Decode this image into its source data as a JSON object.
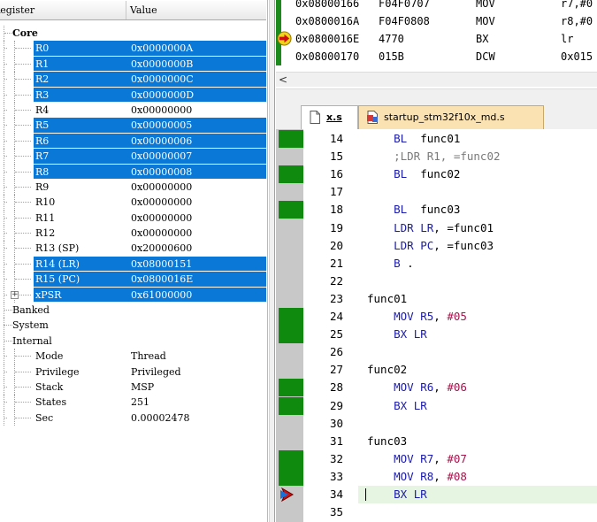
{
  "registers": {
    "header": {
      "name": "Register",
      "value": "Value"
    },
    "rows": [
      {
        "name": "Core",
        "value": "",
        "indent": 1,
        "bold": true,
        "selected": false
      },
      {
        "name": "R0",
        "value": "0x0000000A",
        "indent": 2,
        "selected": true
      },
      {
        "name": "R1",
        "value": "0x0000000B",
        "indent": 2,
        "selected": true
      },
      {
        "name": "R2",
        "value": "0x0000000C",
        "indent": 2,
        "selected": true
      },
      {
        "name": "R3",
        "value": "0x0000000D",
        "indent": 2,
        "selected": true
      },
      {
        "name": "R4",
        "value": "0x00000000",
        "indent": 2,
        "selected": false
      },
      {
        "name": "R5",
        "value": "0x00000005",
        "indent": 2,
        "selected": true
      },
      {
        "name": "R6",
        "value": "0x00000006",
        "indent": 2,
        "selected": true
      },
      {
        "name": "R7",
        "value": "0x00000007",
        "indent": 2,
        "selected": true
      },
      {
        "name": "R8",
        "value": "0x00000008",
        "indent": 2,
        "selected": true
      },
      {
        "name": "R9",
        "value": "0x00000000",
        "indent": 2,
        "selected": false
      },
      {
        "name": "R10",
        "value": "0x00000000",
        "indent": 2,
        "selected": false
      },
      {
        "name": "R11",
        "value": "0x00000000",
        "indent": 2,
        "selected": false
      },
      {
        "name": "R12",
        "value": "0x00000000",
        "indent": 2,
        "selected": false
      },
      {
        "name": "R13 (SP)",
        "value": "0x20000600",
        "indent": 2,
        "selected": false
      },
      {
        "name": "R14 (LR)",
        "value": "0x08000151",
        "indent": 2,
        "selected": true
      },
      {
        "name": "R15 (PC)",
        "value": "0x0800016E",
        "indent": 2,
        "selected": true
      },
      {
        "name": "xPSR",
        "value": "0x61000000",
        "indent": 2,
        "selected": true,
        "expandable": true,
        "expand_symbol": "+"
      },
      {
        "name": "Banked",
        "value": "",
        "indent": 0,
        "selected": false
      },
      {
        "name": "System",
        "value": "",
        "indent": 0,
        "selected": false
      },
      {
        "name": "Internal",
        "value": "",
        "indent": 0,
        "selected": false
      },
      {
        "name": "Mode",
        "value": "Thread",
        "indent": 2,
        "selected": false
      },
      {
        "name": "Privilege",
        "value": "Privileged",
        "indent": 2,
        "selected": false
      },
      {
        "name": "Stack",
        "value": "MSP",
        "indent": 2,
        "selected": false
      },
      {
        "name": "States",
        "value": "251",
        "indent": 2,
        "selected": false
      },
      {
        "name": "Sec",
        "value": "0.00002478",
        "indent": 2,
        "selected": false
      }
    ]
  },
  "disassembly": {
    "rows": [
      {
        "addr": "0x08000166",
        "opcode": "F04F0707",
        "mnemonic": "MOV",
        "operand": "r7,#0",
        "executed": true,
        "pc": false
      },
      {
        "addr": "0x0800016A",
        "opcode": "F04F0808",
        "mnemonic": "MOV",
        "operand": "r8,#0",
        "executed": true,
        "pc": false
      },
      {
        "addr": "0x0800016E",
        "opcode": "4770",
        "mnemonic": "BX",
        "operand": "lr",
        "executed": true,
        "pc": true
      },
      {
        "addr": "0x08000170",
        "opcode": "015B",
        "mnemonic": "DCW",
        "operand": "0x015",
        "executed": true,
        "pc": false
      }
    ],
    "scroll_left_symbol": "<"
  },
  "tabs": [
    {
      "label": "x.s",
      "active": true
    },
    {
      "label": "startup_stm32f10x_md.s",
      "active": false
    }
  ],
  "editor": {
    "lines": [
      {
        "n": "14",
        "tokens": [
          [
            "kw",
            "    BL  "
          ],
          [
            "pl",
            "func01"
          ]
        ],
        "mark": true
      },
      {
        "n": "15",
        "tokens": [
          [
            "cm",
            "    ;LDR R1, =func02"
          ]
        ],
        "mark": false
      },
      {
        "n": "16",
        "tokens": [
          [
            "kw",
            "    BL  "
          ],
          [
            "pl",
            "func02"
          ]
        ],
        "mark": true
      },
      {
        "n": "17",
        "tokens": [],
        "mark": false
      },
      {
        "n": "18",
        "tokens": [
          [
            "kw",
            "    BL  "
          ],
          [
            "pl",
            "func03"
          ]
        ],
        "mark": true
      },
      {
        "n": "19",
        "tokens": [
          [
            "kw",
            "    LDR "
          ],
          [
            "rg",
            "LR"
          ],
          [
            "pl",
            ", =func01"
          ]
        ],
        "mark": false
      },
      {
        "n": "20",
        "tokens": [
          [
            "kw",
            "    LDR "
          ],
          [
            "rg",
            "PC"
          ],
          [
            "pl",
            ", =func03"
          ]
        ],
        "mark": false
      },
      {
        "n": "21",
        "tokens": [
          [
            "kw",
            "    B "
          ],
          [
            "pl",
            "."
          ]
        ],
        "mark": false
      },
      {
        "n": "22",
        "tokens": [],
        "mark": false
      },
      {
        "n": "23",
        "tokens": [
          [
            "pl",
            "func01"
          ]
        ],
        "mark": false
      },
      {
        "n": "24",
        "tokens": [
          [
            "kw",
            "    MOV "
          ],
          [
            "rg",
            "R5"
          ],
          [
            "pl",
            ", "
          ],
          [
            "nm",
            "#05"
          ]
        ],
        "mark": true
      },
      {
        "n": "25",
        "tokens": [
          [
            "kw",
            "    BX "
          ],
          [
            "rg",
            "LR"
          ]
        ],
        "mark": true
      },
      {
        "n": "26",
        "tokens": [],
        "mark": false
      },
      {
        "n": "27",
        "tokens": [
          [
            "pl",
            "func02"
          ]
        ],
        "mark": false
      },
      {
        "n": "28",
        "tokens": [
          [
            "kw",
            "    MOV "
          ],
          [
            "rg",
            "R6"
          ],
          [
            "pl",
            ", "
          ],
          [
            "nm",
            "#06"
          ]
        ],
        "mark": true
      },
      {
        "n": "29",
        "tokens": [
          [
            "kw",
            "    BX "
          ],
          [
            "rg",
            "LR"
          ]
        ],
        "mark": true
      },
      {
        "n": "30",
        "tokens": [],
        "mark": false
      },
      {
        "n": "31",
        "tokens": [
          [
            "pl",
            "func03"
          ]
        ],
        "mark": false
      },
      {
        "n": "32",
        "tokens": [
          [
            "kw",
            "    MOV "
          ],
          [
            "rg",
            "R7"
          ],
          [
            "pl",
            ", "
          ],
          [
            "nm",
            "#07"
          ]
        ],
        "mark": true
      },
      {
        "n": "33",
        "tokens": [
          [
            "kw",
            "    MOV "
          ],
          [
            "rg",
            "R8"
          ],
          [
            "pl",
            ", "
          ],
          [
            "nm",
            "#08"
          ]
        ],
        "mark": true
      },
      {
        "n": "34",
        "tokens": [
          [
            "kw",
            "    BX "
          ],
          [
            "rg",
            "LR"
          ]
        ],
        "mark": false,
        "current": true
      },
      {
        "n": "35",
        "tokens": [],
        "mark": false
      }
    ]
  },
  "colors": {
    "selection": "#0a78d6",
    "exec_mark": "#0f8a0f",
    "current_line": "#e6f5e1",
    "pc_arrow": "#cc1010",
    "tab_active_bg": "#ffffff",
    "tab_inactive_bg": "#fbe2b3"
  },
  "icons": {
    "pc_marker": "pc-arrow-icon",
    "current_line_marker": "current-line-arrow-icon",
    "file_icon": "file-icon",
    "asm_file_icon": "asm-file-icon"
  }
}
